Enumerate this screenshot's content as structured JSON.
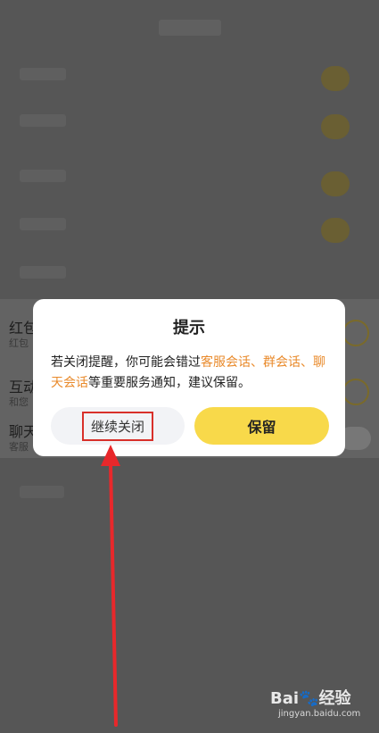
{
  "background": {
    "rows": [
      {
        "label": "红包",
        "sub": "红包"
      },
      {
        "label": "互动",
        "sub": "和您"
      },
      {
        "label": "聊天",
        "sub": "客服"
      }
    ]
  },
  "dialog": {
    "title": "提示",
    "message_parts": [
      {
        "text": "若关闭提醒，你可能会错过",
        "highlight": false
      },
      {
        "text": "客服会话、群会话、聊天会话",
        "highlight": true
      },
      {
        "text": "等重要服务通知，建议保留。",
        "highlight": false
      }
    ],
    "continue_label": "继续关闭",
    "keep_label": "保留"
  },
  "colors": {
    "accent_yellow": "#f8d94a",
    "highlight_orange": "#e98a2b",
    "annotation_red": "#e8282b"
  },
  "watermark": {
    "logo": "Bai🐾经验",
    "url": "jingyan.baidu.com"
  }
}
